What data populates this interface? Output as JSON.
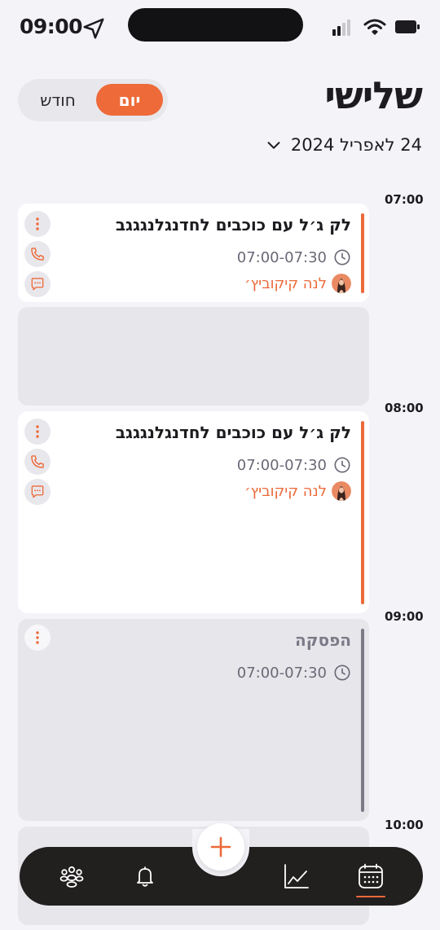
{
  "status_bar": {
    "time": "09:00"
  },
  "header": {
    "title": "שלישי",
    "date": "24 לאפריל 2024",
    "toggle": {
      "day_label": "יום",
      "month_label": "חודש",
      "selected": "day"
    }
  },
  "schedule": {
    "hours": [
      "07:00",
      "08:00",
      "09:00",
      "10:00"
    ],
    "appointments": [
      {
        "title": "לק ג׳ל עם כוכבים לחדנגלנגגגב",
        "time": "07:00-07:30",
        "client": "לנה קיקוביץ׳"
      },
      {
        "title": "לק ג׳ל עם כוכבים לחדנגלנגגגב",
        "time": "07:00-07:30",
        "client": "לנה קיקוביץ׳"
      }
    ],
    "break": {
      "title": "הפסקה",
      "time": "07:00-07:30"
    }
  },
  "nav": {
    "items": [
      "clients",
      "notifications",
      "add",
      "statistics",
      "calendar"
    ],
    "active": "calendar"
  },
  "colors": {
    "accent": "#ec6a39",
    "break_bar": "#7d7a88",
    "nav_background": "#221f1f",
    "page_background": "#f4f3f8"
  },
  "icons": [
    "location-icon",
    "signal-icon",
    "wifi-icon",
    "battery-icon",
    "chevron-down-icon",
    "clock-icon",
    "more-vertical-icon",
    "phone-icon",
    "chat-icon",
    "people-icon",
    "bell-icon",
    "plus-icon",
    "chart-line-icon",
    "calendar-icon"
  ]
}
